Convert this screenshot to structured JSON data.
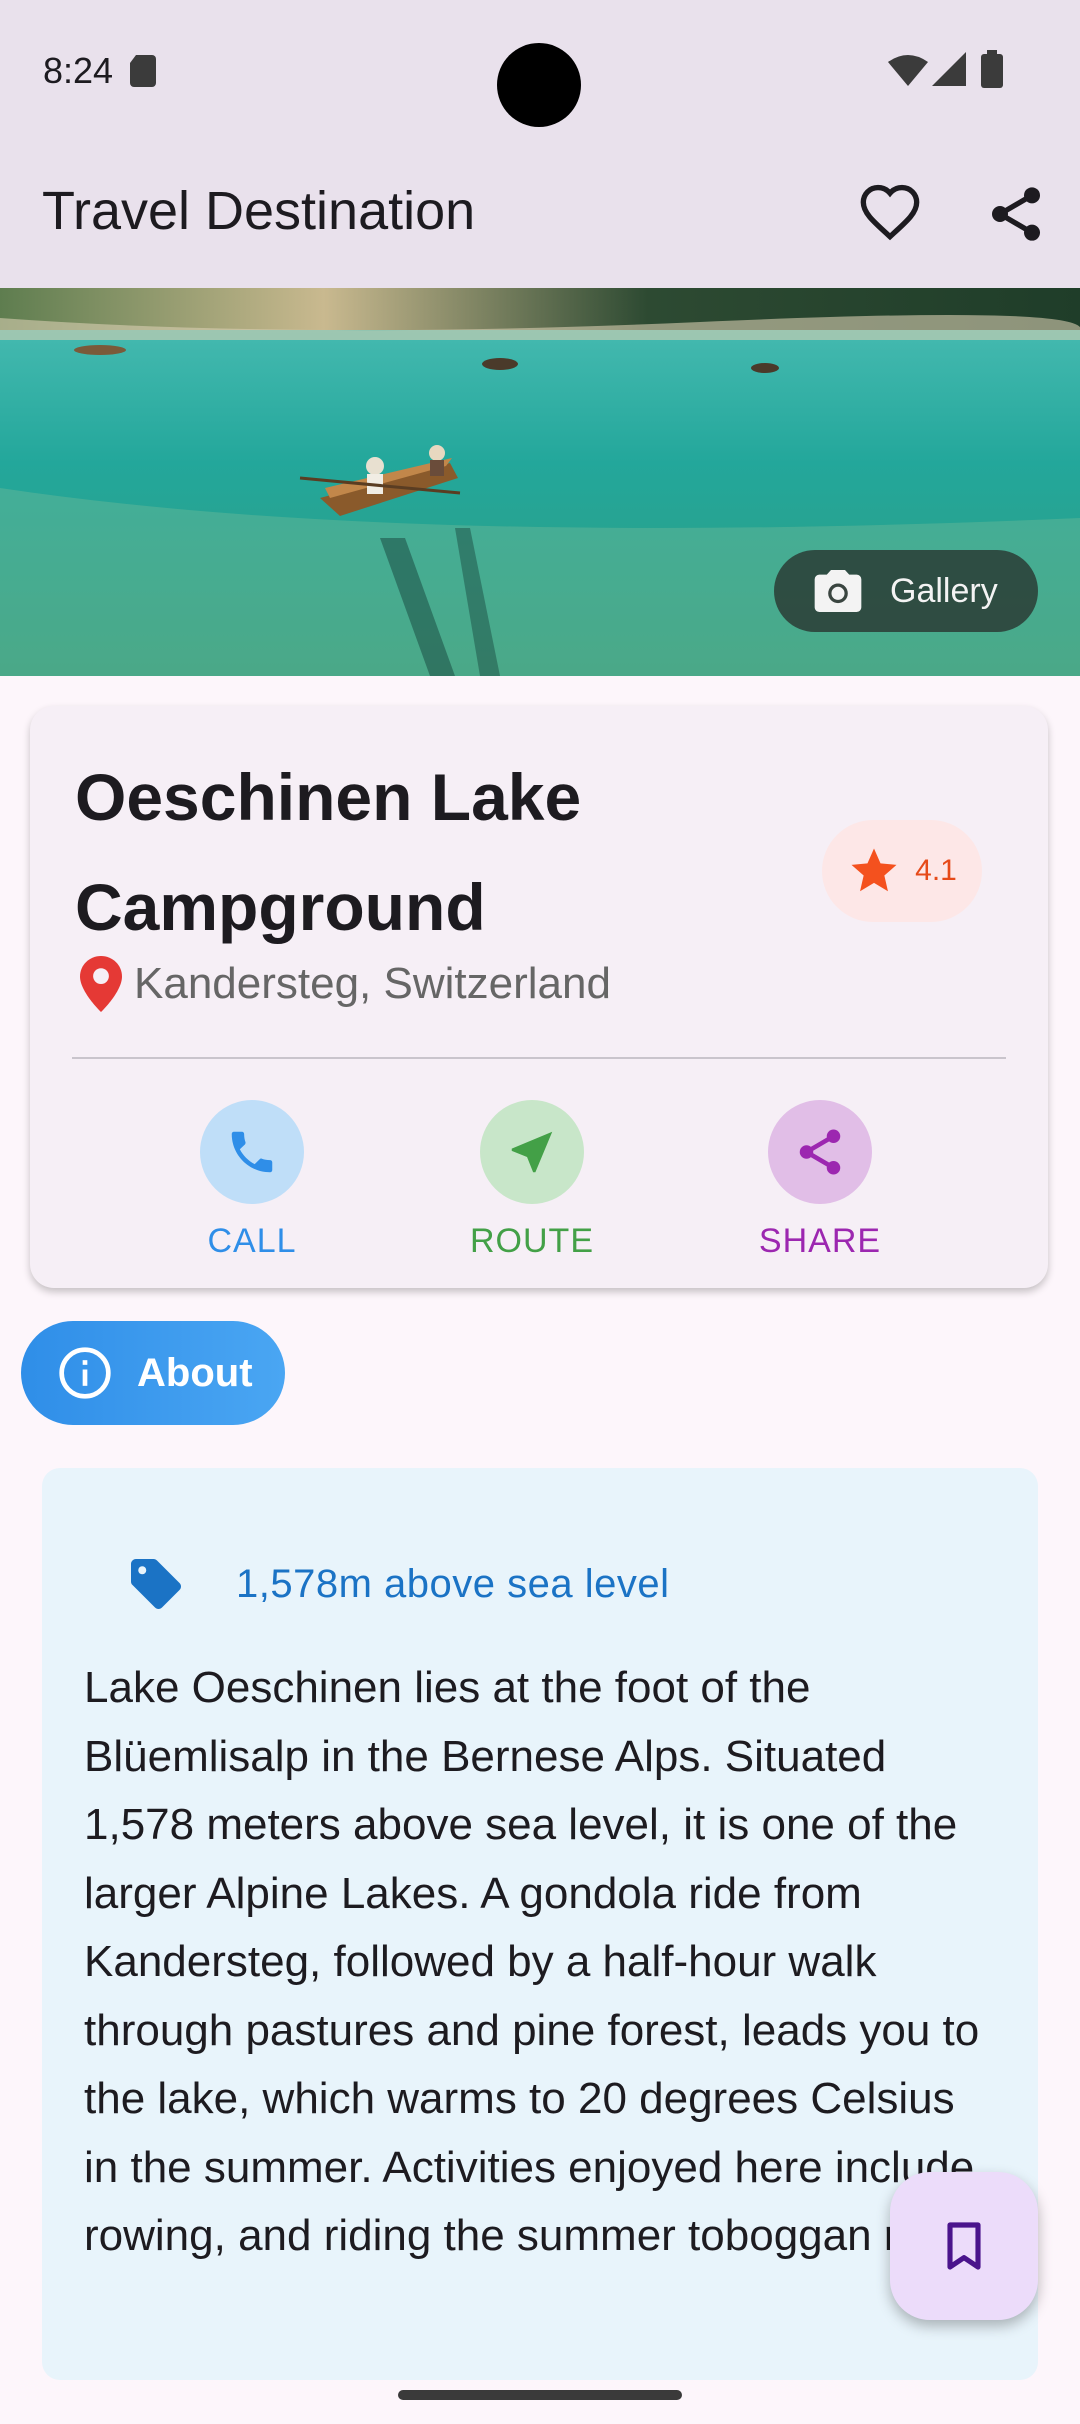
{
  "status_bar": {
    "time": "8:24",
    "icons": [
      "sd-card-icon",
      "wifi-icon",
      "signal-icon",
      "battery-icon"
    ]
  },
  "app_bar": {
    "title": "Travel Destination",
    "actions": [
      "favorite-outline-icon",
      "share-icon"
    ]
  },
  "hero": {
    "gallery_label": "Gallery",
    "gallery_icon": "camera-icon"
  },
  "place": {
    "name": "Oeschinen Lake Campground",
    "rating": "4.1",
    "location": "Kandersteg, Switzerland"
  },
  "actions": [
    {
      "label": "CALL",
      "icon": "phone-icon",
      "color": "#2f8ee8",
      "bg": "#bfdef8"
    },
    {
      "label": "ROUTE",
      "icon": "navigation-icon",
      "color": "#43a047",
      "bg": "#c8e6c9"
    },
    {
      "label": "SHARE",
      "icon": "share-icon",
      "color": "#9c27b0",
      "bg": "#e1bee7"
    }
  ],
  "about": {
    "tab_label": "About",
    "tag_text": "1,578m above sea level",
    "description": "Lake Oeschinen lies at the foot of the Blüemlisalp in the Bernese Alps. Situated 1,578 meters above sea level, it is one of the larger Alpine Lakes. A gondola ride from Kandersteg, followed by a half-hour walk through pastures and pine forest, leads you to the lake, which warms to 20 degrees Celsius in the summer. Activities enjoyed here include rowing, and riding the summer toboggan run."
  },
  "fab": {
    "icon": "bookmark-icon"
  },
  "colors": {
    "app_bar_bg": "#e9e1ec",
    "rating_accent": "#e64a19",
    "about_accent": "#2f8ee8",
    "tag_text": "#1b73c5"
  }
}
